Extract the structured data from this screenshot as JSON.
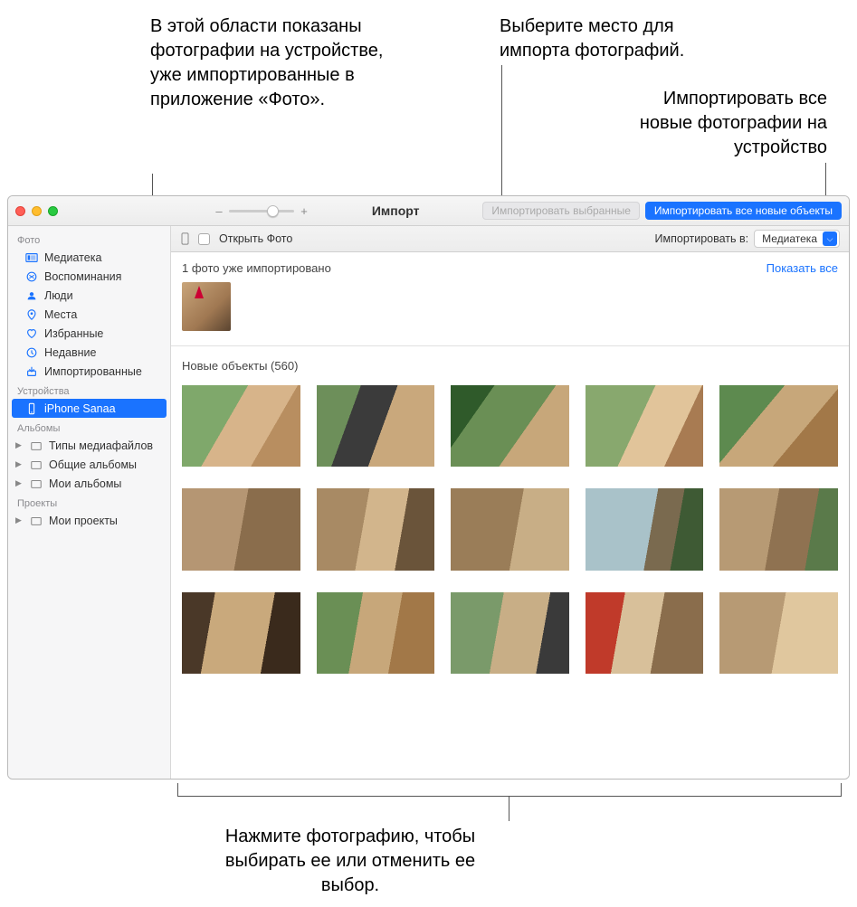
{
  "callouts": {
    "already_imported": "В этой области показаны фотографии на устройстве, уже импортированные в приложение «Фото».",
    "choose_destination": "Выберите место для импорта фотографий.",
    "import_all_new": "Импортировать все новые фотографии на устройство",
    "click_to_toggle": "Нажмите фотографию, чтобы выбирать ее или отменить ее выбор."
  },
  "titlebar": {
    "title": "Импорт",
    "import_selected_label": "Импортировать выбранные",
    "import_all_label": "Импортировать все новые объекты",
    "zoom_minus": "–",
    "zoom_plus": "+"
  },
  "subbar": {
    "open_photos_label": "Открыть Фото",
    "import_to_label": "Импортировать в:",
    "destination_value": "Медиатека"
  },
  "sidebar": {
    "section_photo": "Фото",
    "items_photo": [
      {
        "label": "Медиатека",
        "icon": "library"
      },
      {
        "label": "Воспоминания",
        "icon": "memories"
      },
      {
        "label": "Люди",
        "icon": "people"
      },
      {
        "label": "Места",
        "icon": "places"
      },
      {
        "label": "Избранные",
        "icon": "favorite"
      },
      {
        "label": "Недавние",
        "icon": "recent"
      },
      {
        "label": "Импортированные",
        "icon": "imported"
      }
    ],
    "section_devices": "Устройства",
    "device_item": {
      "label": "iPhone Sanaa",
      "icon": "iphone"
    },
    "section_albums": "Альбомы",
    "items_albums": [
      {
        "label": "Типы медиафайлов"
      },
      {
        "label": "Общие альбомы"
      },
      {
        "label": "Мои альбомы"
      }
    ],
    "section_projects": "Проекты",
    "items_projects": [
      {
        "label": "Мои проекты"
      }
    ]
  },
  "content": {
    "already_imported_title": "1 фото уже импортировано",
    "show_all_label": "Показать все",
    "new_items_title": "Новые объекты (560)"
  }
}
